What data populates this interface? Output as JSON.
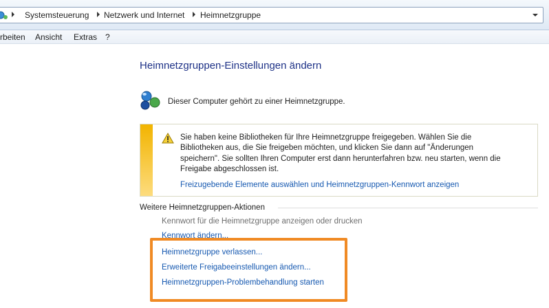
{
  "address_bar": {
    "crumbs": [
      "Systemsteuerung",
      "Netzwerk und Internet",
      "Heimnetzgruppe"
    ],
    "icon": "network-globe-icon"
  },
  "menu": {
    "items": [
      "rbeiten",
      "Ansicht",
      "Extras",
      "?"
    ]
  },
  "main": {
    "title": "Heimnetzgruppen-Einstellungen ändern",
    "status_text": "Dieser Computer gehört zu einer Heimnetzgruppe.",
    "warning": {
      "text": "Sie haben keine Bibliotheken für Ihre Heimnetzgruppe freigegeben. Wählen Sie die Bibliotheken aus, die Sie freigeben möchten, und klicken Sie dann auf \"Änderungen speichern\". Sie sollten Ihren Computer erst dann herunterfahren bzw. neu starten, wenn die Freigabe abgeschlossen ist.",
      "link": "Freizugebende Elemente auswählen und Heimnetzgruppen-Kennwort anzeigen",
      "accent_color": "#f2b400"
    },
    "section": {
      "title": "Weitere Heimnetzgruppen-Aktionen",
      "disabled_action": "Kennwort für die Heimnetzgruppe anzeigen oder drucken",
      "links": [
        "Kennwort ändern...",
        "Heimnetzgruppe verlassen...",
        "Erweiterte Freigabeeinstellungen ändern...",
        "Heimnetzgruppen-Problembehandlung starten"
      ]
    },
    "highlight_color": "#f08a24"
  }
}
